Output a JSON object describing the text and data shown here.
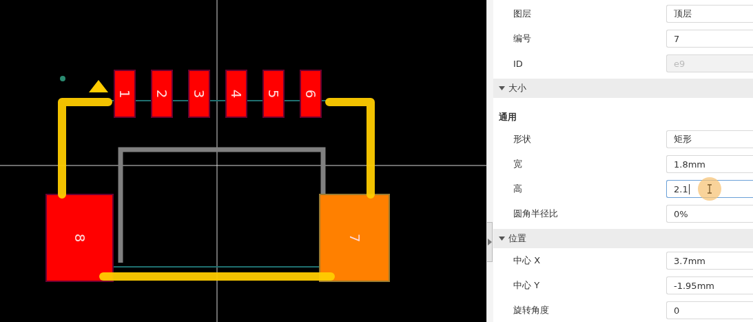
{
  "canvas": {
    "pads": [
      {
        "label": "1",
        "selected": false
      },
      {
        "label": "2",
        "selected": false
      },
      {
        "label": "3",
        "selected": false
      },
      {
        "label": "4",
        "selected": false
      },
      {
        "label": "5",
        "selected": false
      },
      {
        "label": "6",
        "selected": false
      },
      {
        "label": "7",
        "selected": true
      },
      {
        "label": "8",
        "selected": false
      }
    ]
  },
  "panel": {
    "rows": [
      {
        "kind": "field",
        "label": "图层",
        "value": "顶层",
        "disabled": false,
        "focused": false
      },
      {
        "kind": "field",
        "label": "编号",
        "value": "7",
        "disabled": false,
        "focused": false
      },
      {
        "kind": "field",
        "label": "ID",
        "value": "e9",
        "disabled": true,
        "focused": false
      },
      {
        "kind": "section",
        "label": "大小",
        "expanded": true
      },
      {
        "kind": "group",
        "label": "通用"
      },
      {
        "kind": "field",
        "label": "形状",
        "value": "矩形",
        "disabled": false,
        "focused": false
      },
      {
        "kind": "field",
        "label": "宽",
        "value": "1.8mm",
        "disabled": false,
        "focused": false
      },
      {
        "kind": "field",
        "label": "高",
        "value": "2.1",
        "disabled": false,
        "focused": true
      },
      {
        "kind": "field",
        "label": "圆角半径比",
        "value": "0%",
        "disabled": false,
        "focused": false
      },
      {
        "kind": "section",
        "label": "位置",
        "expanded": true
      },
      {
        "kind": "field",
        "label": "中心 X",
        "value": "3.7mm",
        "disabled": false,
        "focused": false
      },
      {
        "kind": "field",
        "label": "中心 Y",
        "value": "-1.95mm",
        "disabled": false,
        "focused": false
      },
      {
        "kind": "field",
        "label": "旋转角度",
        "value": "0",
        "disabled": false,
        "focused": false
      }
    ]
  }
}
